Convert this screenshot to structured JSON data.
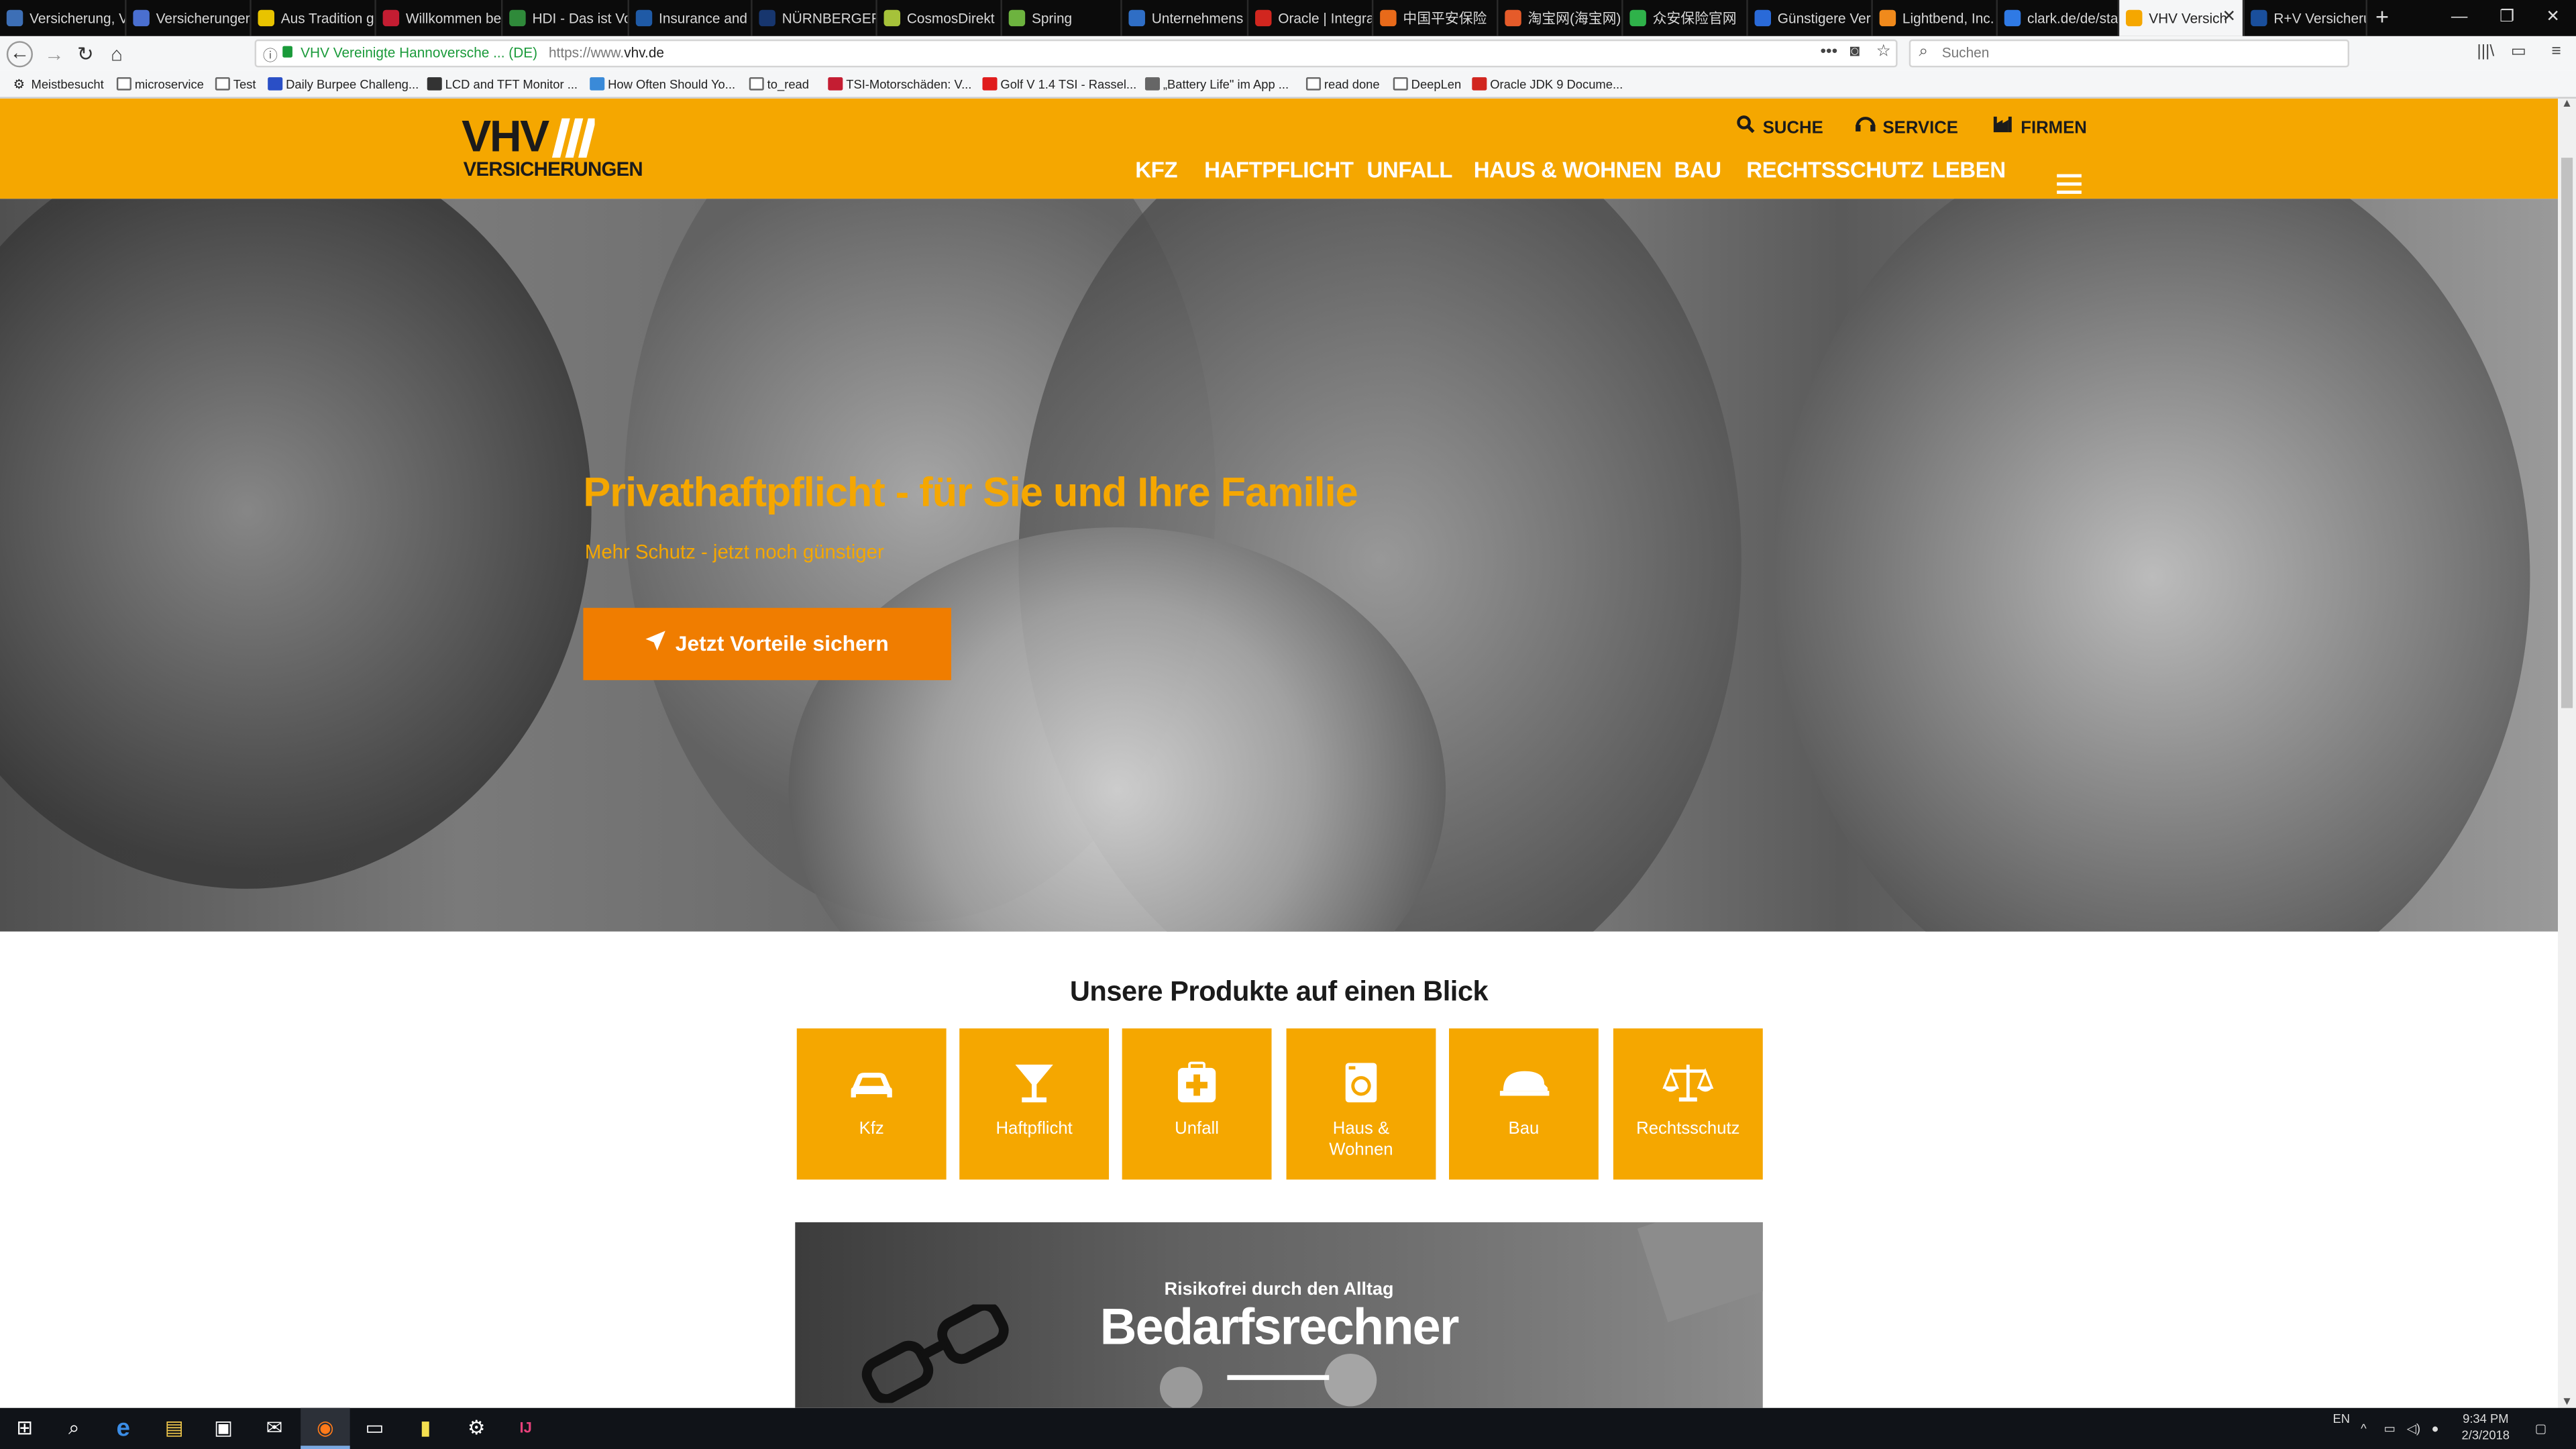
{
  "browser": {
    "tabs": [
      {
        "title": "Versicherung, Vo",
        "fav": "#3d6fb6"
      },
      {
        "title": "Versicherungen",
        "fav": "#4a6fd0"
      },
      {
        "title": "Aus Tradition g",
        "fav": "#e8c300"
      },
      {
        "title": "Willkommen be",
        "fav": "#c41d32"
      },
      {
        "title": "HDI - Das ist Vo",
        "fav": "#2f8a3a"
      },
      {
        "title": "Insurance and",
        "fav": "#1f5aa6"
      },
      {
        "title": "NÜRNBERGER",
        "fav": "#17366e"
      },
      {
        "title": "CosmosDirekt",
        "fav": "#a6c23a"
      },
      {
        "title": "Spring",
        "fav": "#6db33f"
      },
      {
        "title": "Unternehmens",
        "fav": "#2f6ec5"
      },
      {
        "title": "Oracle | Integra",
        "fav": "#d1261f"
      },
      {
        "title": "中国平安保险",
        "fav": "#e86a1a"
      },
      {
        "title": "淘宝网(海宝网)",
        "fav": "#e55b2a"
      },
      {
        "title": "众安保险官网",
        "fav": "#2fb24a"
      },
      {
        "title": "Günstigere Ver",
        "fav": "#2a6ad8"
      },
      {
        "title": "Lightbend, Inc.",
        "fav": "#f08a1c"
      },
      {
        "title": "clark.de/de/sta",
        "fav": "#2f7ae5"
      },
      {
        "title": "VHV Versich",
        "fav": "#f5a700"
      },
      {
        "title": "R+V Versicheru",
        "fav": "#1a4f9c"
      }
    ],
    "active_tab_index": 17,
    "new_tab": "+",
    "window_controls": [
      "—",
      "❐",
      "✕"
    ],
    "url_bar": {
      "identity": "VHV Vereinigte Hannoversche ... (DE)",
      "url_prefix": "https://www.",
      "url_domain": "vhv.de",
      "actions": [
        "•••",
        "◙",
        "☆"
      ]
    },
    "search": {
      "placeholder": "Suchen"
    },
    "toolbar_icons": [
      "|||\\",
      "▭",
      "≡"
    ],
    "bookmarks": [
      {
        "label": "Meistbesucht",
        "icon": "gear"
      },
      {
        "label": "microservice",
        "icon": "folder"
      },
      {
        "label": "Test",
        "icon": "folder"
      },
      {
        "label": "Daily Burpee Challeng...",
        "icon": "#2a4fc6"
      },
      {
        "label": "LCD and TFT Monitor ...",
        "icon": "#333333"
      },
      {
        "label": "How Often Should Yo...",
        "icon": "#3a8ad8"
      },
      {
        "label": "to_read",
        "icon": "folder"
      },
      {
        "label": "TSI-Motorschäden: V...",
        "icon": "#c41d32"
      },
      {
        "label": "Golf V 1.4 TSI - Rassel...",
        "icon": "#e01c1c"
      },
      {
        "label": "„Battery Life\" im App ...",
        "icon": "#666666"
      },
      {
        "label": "read done",
        "icon": "folder"
      },
      {
        "label": "DeepLen",
        "icon": "folder"
      },
      {
        "label": "Oracle JDK 9 Docume...",
        "icon": "#d1261f"
      }
    ]
  },
  "site": {
    "logo": {
      "main": "VHV",
      "sub": "VERSICHERUNGEN"
    },
    "utility_nav": [
      {
        "icon": "search-icon",
        "label": "SUCHE"
      },
      {
        "icon": "headset-icon",
        "label": "SERVICE"
      },
      {
        "icon": "factory-icon",
        "label": "FIRMEN"
      }
    ],
    "main_nav": [
      "KFZ",
      "HAFTPFLICHT",
      "UNFALL",
      "HAUS & WOHNEN",
      "BAU",
      "RECHTSSCHUTZ",
      "LEBEN"
    ],
    "hero": {
      "title": "Privathaftpflicht - für Sie und Ihre Familie",
      "subtitle": "Mehr Schutz - jetzt noch günstiger",
      "cta": "Jetzt Vorteile sichern"
    },
    "products": {
      "title": "Unsere Produkte auf einen Blick",
      "items": [
        {
          "icon": "car-icon",
          "label": "Kfz"
        },
        {
          "icon": "glass-icon",
          "label": "Haftpflicht"
        },
        {
          "icon": "first-aid-icon",
          "label": "Unfall"
        },
        {
          "icon": "washing-machine-icon",
          "label": "Haus &\nWohnen"
        },
        {
          "icon": "hard-hat-icon",
          "label": "Bau"
        },
        {
          "icon": "scales-icon",
          "label": "Rechtsschutz"
        }
      ]
    },
    "banner": {
      "pre": "Risikofrei durch den Alltag",
      "title": "Bedarfsrechner"
    }
  },
  "taskbar": {
    "apps": [
      "start-icon",
      "search-icon",
      "edge-icon",
      "file-explorer-icon",
      "store-icon",
      "mail-icon",
      "firefox-icon",
      "window-icon",
      "sticky-notes-icon",
      "settings-icon",
      "intellij-icon"
    ],
    "active_app": "firefox-icon",
    "lang": "EN",
    "time": "9:34 PM",
    "date": "2/3/2018"
  },
  "colors": {
    "brand": "#f5a700",
    "cta": "#f07d00",
    "text_dark": "#1b1b1b"
  }
}
